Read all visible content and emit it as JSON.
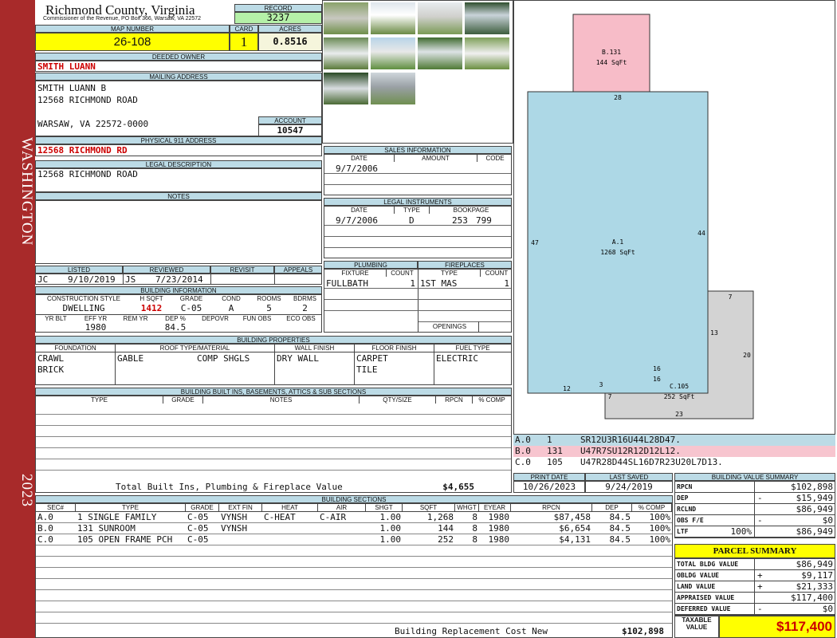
{
  "side": {
    "top": "WASHINGTON",
    "bottom": "2023"
  },
  "head": {
    "county": "Richmond County, Virginia",
    "commissioner": "Commissioner of the Revenue, PO Box 366, Warsaw, VA 22572",
    "record_lbl": "RECORD",
    "record": "3237",
    "map_lbl": "MAP NUMBER",
    "map": "26-108",
    "card_lbl": "CARD",
    "card": "1",
    "acres_lbl": "ACRES",
    "acres": "0.8516"
  },
  "owner": {
    "deeded_lbl": "DEEDED OWNER",
    "deeded": "SMITH LUANN",
    "mailing_lbl": "MAILING ADDRESS",
    "line1": "SMITH LUANN B",
    "line2": "12568 RICHMOND ROAD",
    "line3": "WARSAW, VA 22572-0000",
    "account_lbl": "ACCOUNT",
    "account": "10547",
    "phys_lbl": "PHYSICAL 911 ADDRESS",
    "phys": "12568 RICHMOND RD",
    "legal_lbl": "LEGAL DESCRIPTION",
    "legal": "12568 RICHMOND ROAD",
    "notes_lbl": "NOTES"
  },
  "sales": {
    "title": "SALES INFORMATION",
    "cols": [
      "DATE",
      "AMOUNT",
      "CODE"
    ],
    "date": "9/7/2006"
  },
  "legal_inst": {
    "title": "LEGAL INSTRUMENTS",
    "cols": [
      "DATE",
      "TYPE",
      "BOOKPAGE"
    ],
    "date": "9/7/2006",
    "type": "D",
    "book": "253",
    "page": "799"
  },
  "plumbing": {
    "title": "PLUMBING",
    "cols": [
      "FIXTURE",
      "COUNT"
    ],
    "fixture": "FULLBATH",
    "count": "1"
  },
  "fireplaces": {
    "title": "FIREPLACES",
    "cols": [
      "TYPE",
      "COUNT"
    ],
    "type": "1ST MAS",
    "count": "1",
    "openings": "OPENINGS"
  },
  "listed": {
    "labels": [
      "LISTED",
      "REVIEWED",
      "REVISIT",
      "APPEALS"
    ],
    "listed_by": "JC",
    "listed_date": "9/10/2019",
    "rev_by": "JS",
    "rev_date": "7/23/2014"
  },
  "bldg_info": {
    "title": "BUILDING INFORMATION",
    "cols": [
      "CONSTRUCTION STYLE",
      "H SQFT",
      "GRADE",
      "COND",
      "ROOMS",
      "BDRMS"
    ],
    "style": "DWELLING",
    "hsqft": "1412",
    "grade": "C-05",
    "cond": "A",
    "rooms": "5",
    "bdrms": "2",
    "cols2": [
      "YR BLT",
      "EFF YR",
      "REM YR",
      "DEP %",
      "DEPOVR",
      "FUN OBS",
      "ECO OBS"
    ],
    "eff_yr": "1980",
    "dep": "84.5"
  },
  "props": {
    "title": "BUILDING PROPERTIES",
    "cols": [
      "FOUNDATION",
      "ROOF TYPE/MATERIAL",
      "WALL FINISH",
      "FLOOR FINISH",
      "FUEL TYPE"
    ],
    "found1": "CRAWL",
    "found2": "BRICK",
    "roof1": "GABLE",
    "roof2": "COMP SHGLS",
    "wall": "DRY WALL",
    "floor1": "CARPET",
    "floor2": "TILE",
    "fuel": "ELECTRIC"
  },
  "builtins": {
    "title": "BUILDING BUILT INS, BASEMENTS, ATTICS & SUB SECTIONS",
    "cols": [
      "TYPE",
      "GRADE",
      "NOTES",
      "QTY/SIZE",
      "RPCN",
      "% COMP"
    ],
    "total_lbl": "Total Built Ins, Plumbing & Fireplace Value",
    "total": "$4,655"
  },
  "print": {
    "cols": [
      "PRINT DATE",
      "LAST SAVED"
    ],
    "print_date": "10/26/2023",
    "saved": "9/24/2019"
  },
  "sections": {
    "title": "BUILDING SECTIONS",
    "cols": [
      "SEC#",
      "TYPE",
      "GRADE",
      "EXT FIN",
      "HEAT",
      "AIR",
      "SHGT",
      "SQFT",
      "WHGT",
      "EYEAR",
      "RPCN",
      "DEP",
      "% COMP"
    ],
    "rows": [
      {
        "sec": "A.0",
        "type": "1 SINGLE FAMILY",
        "grade": "C-05",
        "ext": "VYNSH",
        "heat": "C-HEAT",
        "air": "C-AIR",
        "shgt": "1.00",
        "sqft": "1,268",
        "whgt": "8",
        "eyear": "1980",
        "rpcn": "$87,458",
        "dep": "84.5",
        "comp": "100%"
      },
      {
        "sec": "B.0",
        "type": "131 SUNROOM",
        "grade": "C-05",
        "ext": "VYNSH",
        "heat": "",
        "air": "",
        "shgt": "1.00",
        "sqft": "144",
        "whgt": "8",
        "eyear": "1980",
        "rpcn": "$6,654",
        "dep": "84.5",
        "comp": "100%"
      },
      {
        "sec": "C.0",
        "type": "105 OPEN FRAME PCH",
        "grade": "C-05",
        "ext": "",
        "heat": "",
        "air": "",
        "shgt": "1.00",
        "sqft": "252",
        "whgt": "8",
        "eyear": "1980",
        "rpcn": "$4,131",
        "dep": "84.5",
        "comp": "100%"
      }
    ],
    "rcn_lbl": "Building Replacement Cost New",
    "rcn": "$102,898"
  },
  "sketch": {
    "b_label": "B.131",
    "b_area": "144 SqFt",
    "a_label": "A.1",
    "a_area": "1268 SqFt",
    "c_label": "C.105",
    "c_area": "252 SqFt",
    "dims": [
      "28",
      "47",
      "44",
      "7",
      "13",
      "20",
      "16",
      "16",
      "12",
      "3",
      "7",
      "23"
    ],
    "codes": [
      {
        "sec": "A.0",
        "num": "1",
        "code": "SR12U3R16U44L28D47.",
        "color": "#bcdbe6"
      },
      {
        "sec": "B.0",
        "num": "131",
        "code": "U47R7SU12R12D12L12.",
        "color": "#f7c5cf"
      },
      {
        "sec": "C.0",
        "num": "105",
        "code": "U47R28D44SL16D7R23U20L7D13.",
        "color": "#ffffff"
      }
    ],
    "colors": {
      "a": "#add8e6",
      "b": "#f7bcc8",
      "c": "#d3d3d3"
    }
  },
  "bvs": {
    "title": "BUILDING VALUE SUMMARY",
    "rows": [
      {
        "l": "RPCN",
        "s": "",
        "v": "$102,898"
      },
      {
        "l": "DEP",
        "s": "-",
        "v": "$15,949"
      },
      {
        "l": "RCLND",
        "s": "",
        "v": "$86,949"
      },
      {
        "l": "OBS F/E",
        "s": "-",
        "v": "$0"
      },
      {
        "l": "LTF",
        "pct": "100%",
        "s": "",
        "v": "$86,949"
      }
    ]
  },
  "parcel": {
    "title": "PARCEL SUMMARY",
    "rows": [
      {
        "l": "TOTAL BLDG VALUE",
        "s": "",
        "v": "$86,949"
      },
      {
        "l": "OBLDG VALUE",
        "s": "+",
        "v": "$9,117"
      },
      {
        "l": "LAND VALUE",
        "s": "+",
        "v": "$21,333"
      },
      {
        "l": "APPRAISED VALUE",
        "s": "",
        "v": "$117,400"
      },
      {
        "l": "DEFERRED VALUE",
        "s": "-",
        "v": "$0"
      }
    ],
    "taxable_l1": "TAXABLE",
    "taxable_l2": "VALUE",
    "taxable": "$117,400"
  },
  "photos": [
    "photo-1",
    "photo-2",
    "photo-3",
    "photo-4",
    "photo-5",
    "photo-6",
    "photo-7",
    "photo-8",
    "photo-9",
    "photo-10"
  ]
}
